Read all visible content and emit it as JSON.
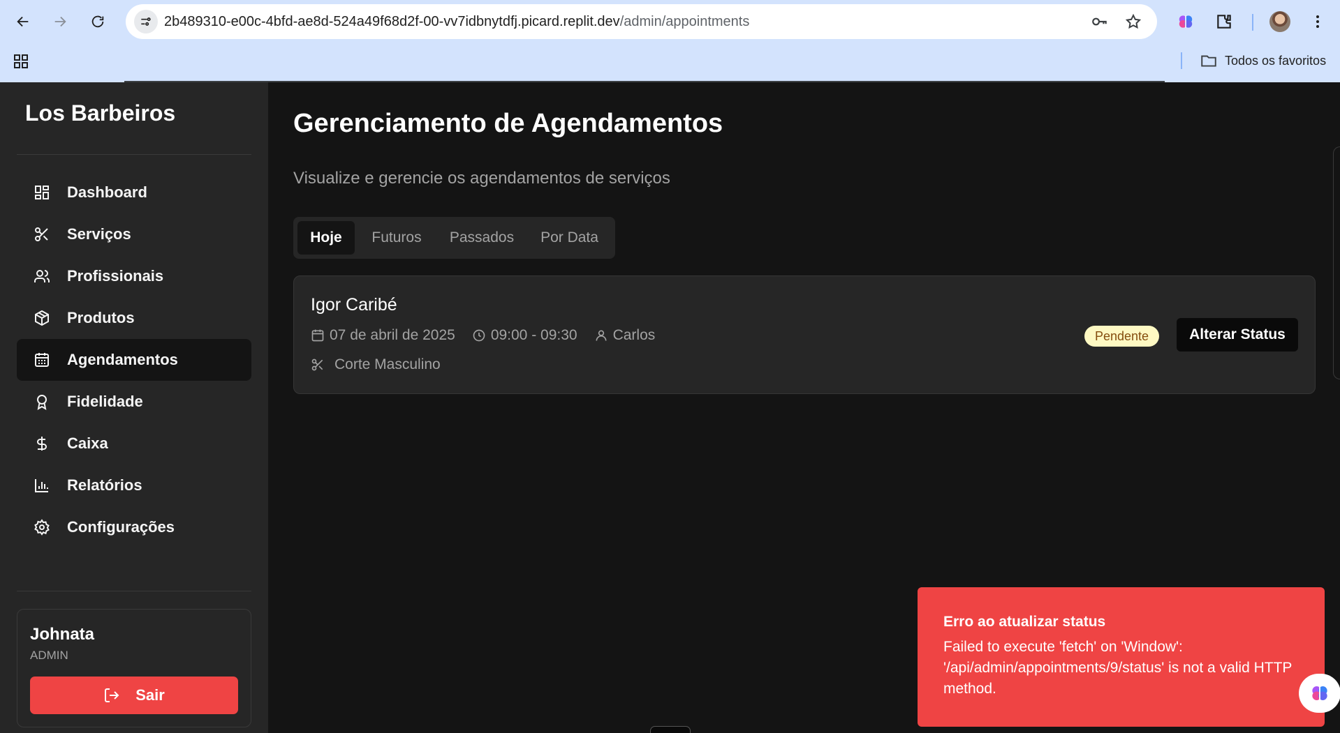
{
  "browser": {
    "url_host": "2b489310-e00c-4bfd-ae8d-524a49f68d2f-00-vv7idbnytdfj.picard.replit.dev",
    "url_path": "/admin/appointments",
    "bookmarks_label": "Todos os favoritos"
  },
  "sidebar": {
    "brand": "Los Barbeiros",
    "items": [
      {
        "label": "Dashboard",
        "icon": "dashboard-icon"
      },
      {
        "label": "Serviços",
        "icon": "scissors-icon"
      },
      {
        "label": "Profissionais",
        "icon": "users-icon"
      },
      {
        "label": "Produtos",
        "icon": "package-icon"
      },
      {
        "label": "Agendamentos",
        "icon": "calendar-icon",
        "active": true
      },
      {
        "label": "Fidelidade",
        "icon": "award-icon"
      },
      {
        "label": "Caixa",
        "icon": "dollar-icon"
      },
      {
        "label": "Relatórios",
        "icon": "bar-chart-icon"
      },
      {
        "label": "Configurações",
        "icon": "gear-icon"
      }
    ],
    "user": {
      "name": "Johnata",
      "role": "ADMIN",
      "logout_label": "Sair"
    }
  },
  "main": {
    "title": "Gerenciamento de Agendamentos",
    "subtitle": "Visualize e gerencie os agendamentos de serviços",
    "tabs": [
      {
        "label": "Hoje",
        "active": true
      },
      {
        "label": "Futuros"
      },
      {
        "label": "Passados"
      },
      {
        "label": "Por Data"
      }
    ],
    "appointment": {
      "client": "Igor Caribé",
      "date": "07 de abril de 2025",
      "time": "09:00 - 09:30",
      "professional": "Carlos",
      "service": "Corte Masculino",
      "status": "Pendente",
      "action_label": "Alterar Status"
    }
  },
  "toast": {
    "title": "Erro ao atualizar status",
    "message": "Failed to execute 'fetch' on 'Window': '/api/admin/appointments/9/status' is not a valid HTTP method."
  },
  "colors": {
    "accent_red": "#ef4444",
    "sidebar_bg": "#262626",
    "main_bg": "#141414",
    "badge_bg": "#fef9c3",
    "badge_text": "#854d0e"
  }
}
